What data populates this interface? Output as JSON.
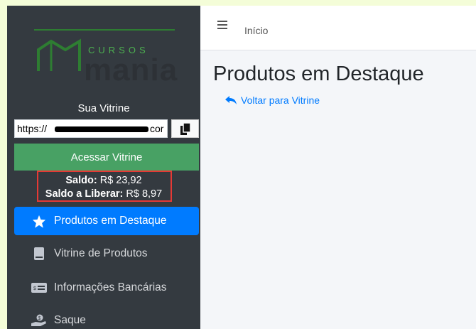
{
  "logo": {
    "top_text": "CURSOS CURSOS",
    "cursos": "CURSOS",
    "mania": "mania"
  },
  "vitrine": {
    "title": "Sua Vitrine",
    "url_value": "https://",
    "url_tail": "cor",
    "access_label": "Acessar Vitrine"
  },
  "saldo": {
    "saldo_label": "Saldo:",
    "saldo_value": " R$ 23,92",
    "liberar_label": "Saldo a Liberar:",
    "liberar_value": " R$ 8,97"
  },
  "nav": [
    {
      "label": "Produtos em Destaque",
      "icon": "star-icon",
      "active": true
    },
    {
      "label": "Vitrine de Produtos",
      "icon": "book-icon",
      "active": false
    },
    {
      "label": "Informações Bancárias",
      "icon": "money-icon",
      "active": false
    },
    {
      "label": "Saque",
      "icon": "hand-coin-icon",
      "active": false
    }
  ],
  "header": {
    "breadcrumb": "Início"
  },
  "main": {
    "title": "Produtos em Destaque",
    "back_label": "Voltar para Vitrine"
  },
  "colors": {
    "sidebar": "#343a40",
    "accent": "#007bff",
    "access_button": "#48a164",
    "highlight_border": "#e53935"
  }
}
